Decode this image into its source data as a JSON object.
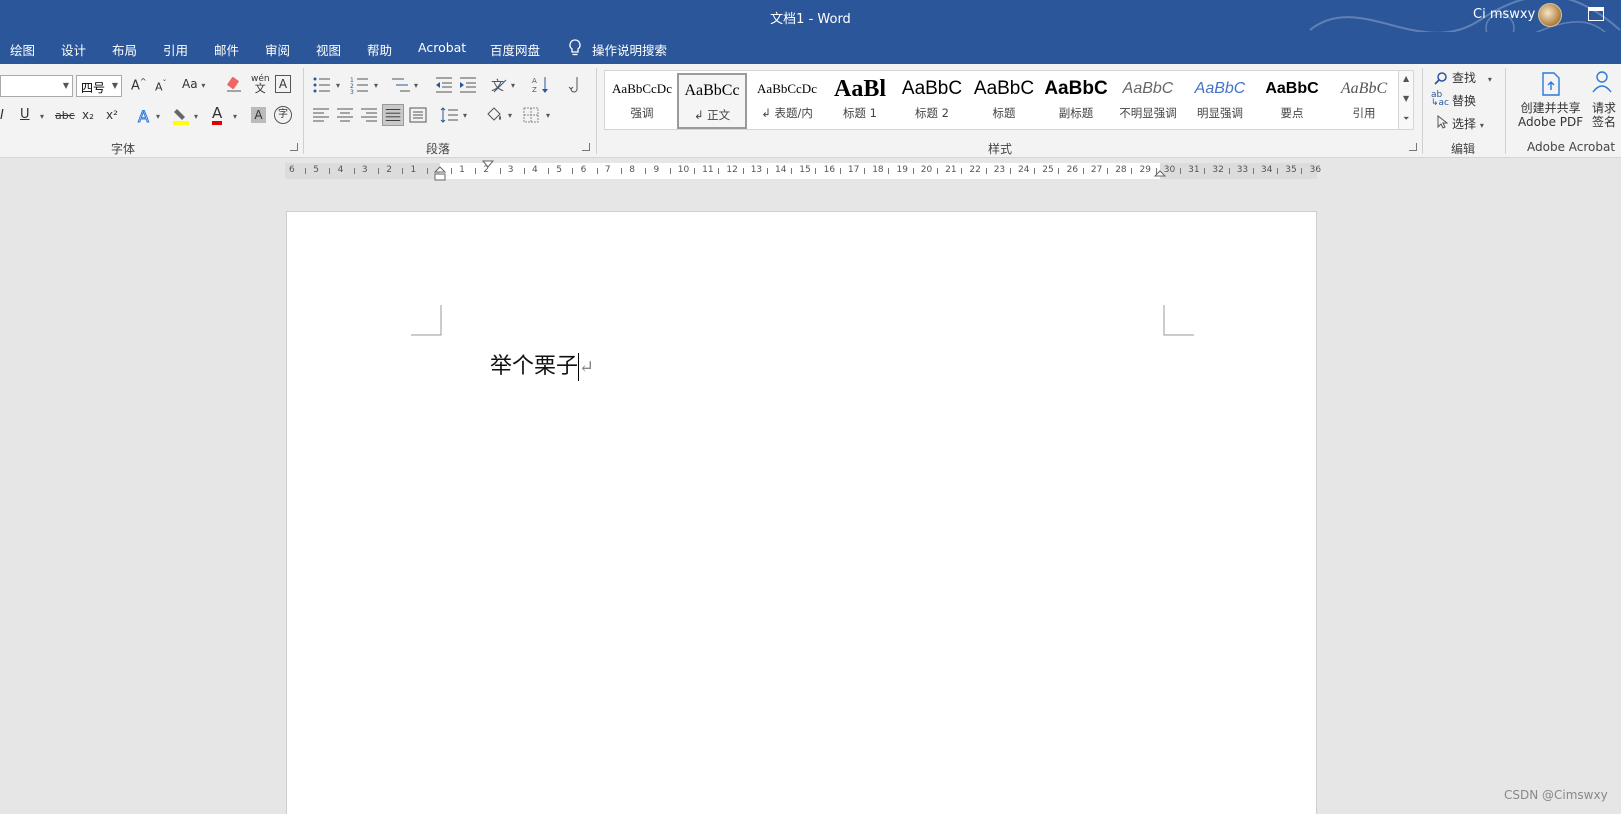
{
  "app": {
    "title": "文档1  -  Word",
    "user": "Ci mswxy"
  },
  "tabs": [
    "绘图",
    "设计",
    "布局",
    "引用",
    "邮件",
    "审阅",
    "视图",
    "帮助",
    "Acrobat",
    "百度网盘"
  ],
  "tell_me": "操作说明搜索",
  "font": {
    "font_name": "",
    "font_size": "四号",
    "change_case": "Aa",
    "phonetic": "wén\n文",
    "bold": "I",
    "underline": "U",
    "strikethrough": "abc",
    "subscript": "x₂",
    "superscript": "x²",
    "font_color": "A",
    "char_shading": "A",
    "enclose": "字",
    "grow": "A",
    "shrink": "A"
  },
  "groups": {
    "font": "字体",
    "paragraph": "段落",
    "styles": "样式",
    "editing": "编辑",
    "acrobat": "Adobe Acrobat"
  },
  "styles": [
    {
      "sample": "AaBbCcDc",
      "label": "强调"
    },
    {
      "sample": "AaBbCc",
      "label": "↲ 正文"
    },
    {
      "sample": "AaBbCcDc",
      "label": "↲ 表题/内"
    },
    {
      "sample": "AaBl",
      "label": "标题 1"
    },
    {
      "sample": "AaBbC",
      "label": "标题 2"
    },
    {
      "sample": "AaBbC",
      "label": "标题"
    },
    {
      "sample": "AaBbC",
      "label": "副标题"
    },
    {
      "sample": "AaBbC",
      "label": "不明显强调"
    },
    {
      "sample": "AaBbC",
      "label": "明显强调"
    },
    {
      "sample": "AaBbC",
      "label": "要点"
    },
    {
      "sample": "AaBbC",
      "label": "引用"
    }
  ],
  "editing": {
    "find": "查找",
    "replace": "替换",
    "select": "选择"
  },
  "acrobat": {
    "create_share_1": "创建并共享",
    "create_share_2": "Adobe PDF",
    "request_1": "请求",
    "request_2": "签名"
  },
  "ruler_numbers": [
    "6",
    "5",
    "4",
    "3",
    "2",
    "1",
    "",
    "1",
    "2",
    "3",
    "4",
    "5",
    "6",
    "7",
    "8",
    "9",
    "10",
    "11",
    "12",
    "13",
    "14",
    "15",
    "16",
    "17",
    "18",
    "19",
    "20",
    "21",
    "22",
    "23",
    "24",
    "25",
    "26",
    "27",
    "28",
    "29",
    "30",
    "31",
    "32",
    "33",
    "34",
    "35",
    "36"
  ],
  "document": {
    "text": "举个栗子",
    "pilcrow": "↵"
  },
  "watermark": "CSDN @Cimswxy",
  "colors": {
    "title_bar": "#2b579a",
    "highlight": "#ffff00",
    "font_color": "#e00000",
    "accent_blue": "#2b579a"
  }
}
